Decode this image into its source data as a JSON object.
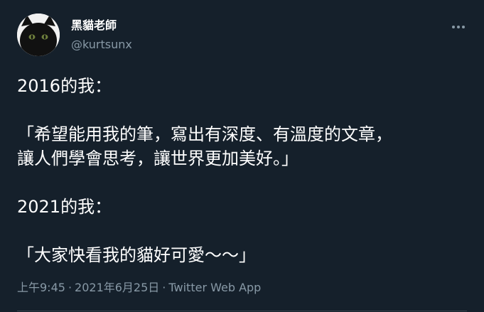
{
  "author": {
    "display_name": "黑貓老師",
    "handle": "@kurtsunx"
  },
  "tweet": {
    "lines": [
      "2016的我：",
      "",
      "「希望能用我的筆，寫出有深度、有溫度的文章，",
      "讓人們學會思考，讓世界更加美好。」",
      "",
      "2021的我：",
      "",
      "「大家快看我的貓好可愛～～」"
    ],
    "time": "上午9:45",
    "date": "2021年6月25日",
    "separator": "·",
    "source": "Twitter Web App"
  },
  "icons": {
    "avatar": "black-cat-avatar",
    "more": "more-horizontal-icon"
  },
  "colors": {
    "background": "#15202b",
    "text": "#ffffff",
    "secondary_text": "#8899a6",
    "divider": "#38444d"
  }
}
